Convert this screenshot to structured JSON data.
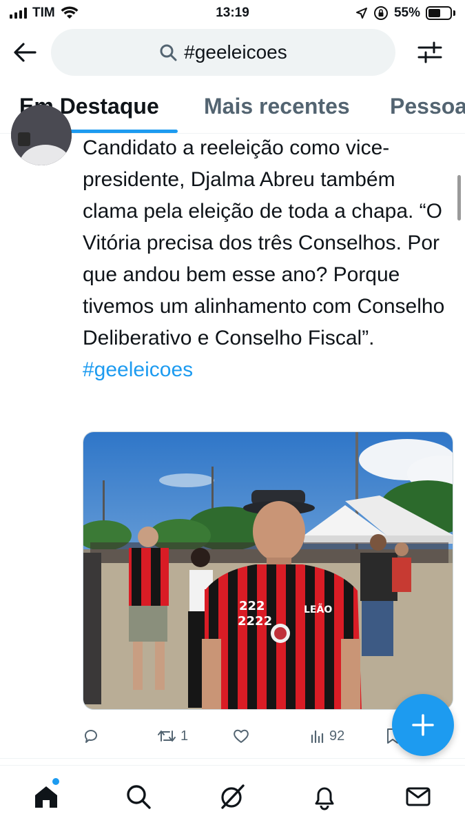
{
  "status_bar": {
    "carrier": "TIM",
    "time": "13:19",
    "battery": "55%",
    "battery_level": 0.55,
    "icons": [
      "signal-icon",
      "wifi-icon",
      "location-icon",
      "orientation-lock-icon",
      "battery-icon"
    ]
  },
  "header": {
    "back_icon": "arrow-left-icon",
    "search_query": "#geeleicoes",
    "filter_icon": "sliders-icon"
  },
  "tabs": [
    {
      "label": "Em Destaque",
      "active": true
    },
    {
      "label": "Mais recentes",
      "active": false
    },
    {
      "label": "Pessoas",
      "active": false
    }
  ],
  "tweet": {
    "text": "Candidato a reeleição como vice-presidente, Djalma Abreu também clama pela eleição de toda a chapa. “O Vitória precisa dos três Conselhos. Por que andou bem esse ano? Porque tivemos um alinhamento com Conselho Deliberativo e Conselho Fiscal”. ",
    "hashtag": "#geeleicoes",
    "photo": {
      "jersey_number_top": "222",
      "jersey_number_bottom": "2222",
      "jersey_badge": "LEÃO"
    },
    "actions": {
      "replies": "",
      "retweets": "1",
      "likes": "",
      "views": "92"
    }
  },
  "fab_icon": "plus-icon",
  "bottom_nav": [
    "home-icon",
    "search-icon",
    "grok-icon",
    "bell-icon",
    "mail-icon"
  ],
  "colors": {
    "accent": "#1d9bf0",
    "text_primary": "#0f1419",
    "text_secondary": "#536471",
    "search_bg": "#eff3f4"
  }
}
